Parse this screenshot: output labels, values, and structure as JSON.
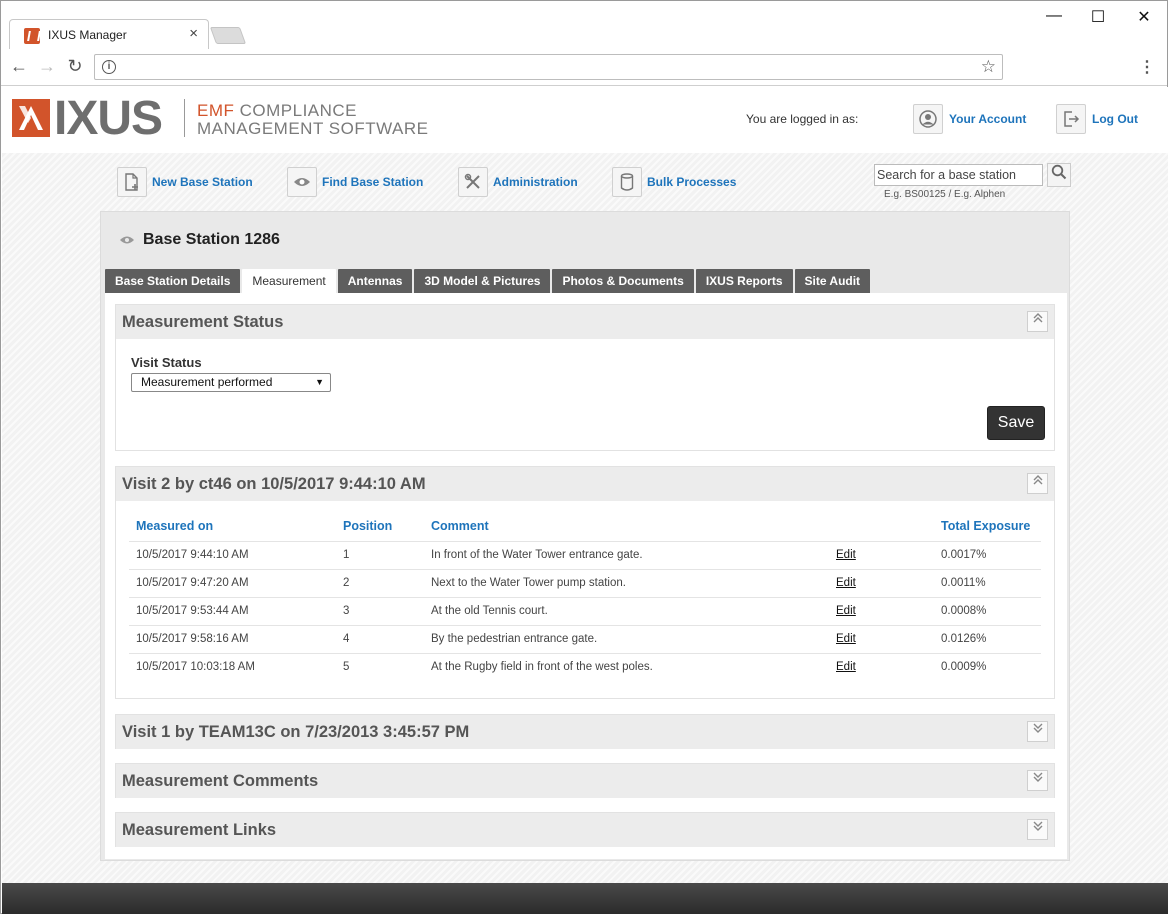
{
  "browser": {
    "tab_title": "IXUS Manager",
    "tab_close": "×",
    "url": "",
    "back": "←",
    "forward": "→",
    "reload": "↻",
    "minimize": "—",
    "maximize": "☐",
    "close": "✕",
    "info": "i",
    "star": "☆",
    "menu": "⋮"
  },
  "header": {
    "logo_word": "IXUS",
    "tagline_emf": "EMF",
    "tagline_line1": " COMPLIANCE",
    "tagline_line2": "MANAGEMENT SOFTWARE",
    "logged_in_label": "You are logged in as:",
    "your_account": "Your Account",
    "log_out": "Log Out"
  },
  "nav": {
    "items": [
      {
        "label": "New Base Station",
        "icon": "new-document-icon"
      },
      {
        "label": "Find Base Station",
        "icon": "eye-icon"
      },
      {
        "label": "Administration",
        "icon": "tools-icon"
      },
      {
        "label": "Bulk Processes",
        "icon": "database-icon"
      }
    ],
    "search_placeholder": "Search for a base station",
    "search_hint": "E.g. BS00125 / E.g. Alphen"
  },
  "base_station": {
    "title": "Base Station 1286"
  },
  "tabs": [
    {
      "label": "Base Station Details",
      "active": false
    },
    {
      "label": "Measurement",
      "active": true
    },
    {
      "label": "Antennas",
      "active": false
    },
    {
      "label": "3D Model & Pictures",
      "active": false
    },
    {
      "label": "Photos & Documents",
      "active": false
    },
    {
      "label": "IXUS Reports",
      "active": false
    },
    {
      "label": "Site Audit",
      "active": false
    }
  ],
  "measurement_status": {
    "title": "Measurement Status",
    "visit_status_label": "Visit Status",
    "visit_status_value": "Measurement performed",
    "save_label": "Save"
  },
  "visit2": {
    "title": "Visit 2 by ct46 on 10/5/2017 9:44:10 AM",
    "columns": [
      "Measured on",
      "Position",
      "Comment",
      "",
      "Total Exposure"
    ],
    "rows": [
      {
        "measured_on": "10/5/2017 9:44:10 AM",
        "position": "1",
        "comment": "In front of the Water Tower entrance gate.",
        "edit": "Edit",
        "exposure": "0.0017%"
      },
      {
        "measured_on": "10/5/2017 9:47:20 AM",
        "position": "2",
        "comment": "Next to the Water Tower pump station.",
        "edit": "Edit",
        "exposure": "0.0011%"
      },
      {
        "measured_on": "10/5/2017 9:53:44 AM",
        "position": "3",
        "comment": "At the old Tennis court.",
        "edit": "Edit",
        "exposure": "0.0008%"
      },
      {
        "measured_on": "10/5/2017 9:58:16 AM",
        "position": "4",
        "comment": "By the pedestrian entrance gate.",
        "edit": "Edit",
        "exposure": "0.0126%"
      },
      {
        "measured_on": "10/5/2017 10:03:18 AM",
        "position": "5",
        "comment": "At the Rugby field in front of the west poles.",
        "edit": "Edit",
        "exposure": "0.0009%"
      }
    ]
  },
  "visit1": {
    "title": "Visit 1 by TEAM13C on 7/23/2013 3:45:57 PM"
  },
  "measurement_comments": {
    "title": "Measurement Comments"
  },
  "measurement_links": {
    "title": "Measurement Links"
  },
  "colors": {
    "brand_orange": "#d2542b",
    "link_blue": "#1e74bb",
    "tab_dark": "#5e5e5e"
  }
}
